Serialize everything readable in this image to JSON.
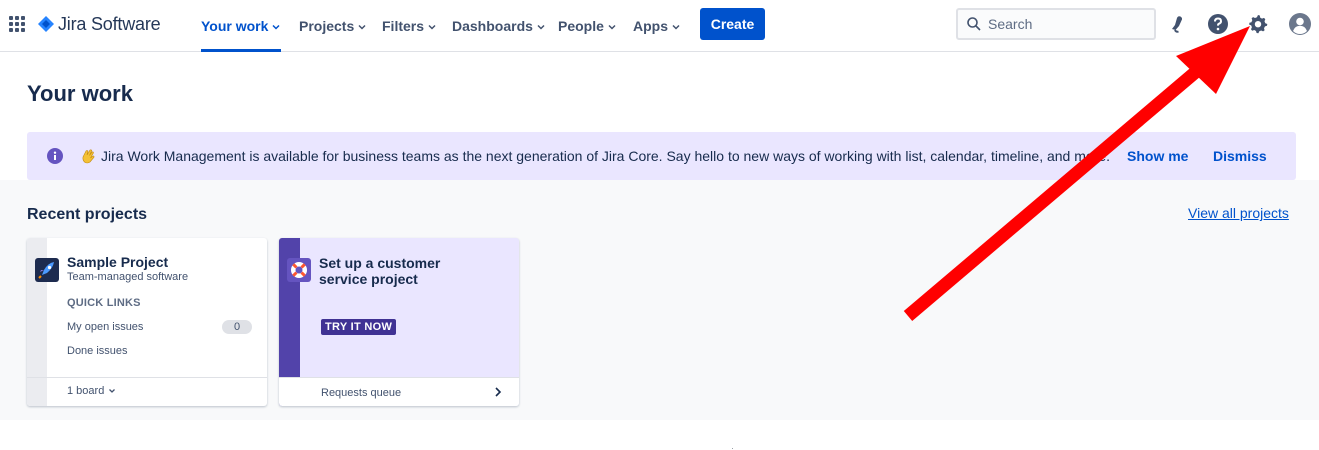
{
  "app": {
    "logo_text": "Jira Software"
  },
  "nav": {
    "items": [
      {
        "label": "Your work",
        "active": true
      },
      {
        "label": "Projects"
      },
      {
        "label": "Filters"
      },
      {
        "label": "Dashboards"
      },
      {
        "label": "People"
      },
      {
        "label": "Apps"
      }
    ],
    "create_label": "Create",
    "search_placeholder": "Search",
    "icons": [
      "notifications-icon",
      "help-icon",
      "settings-icon",
      "profile-avatar-icon"
    ]
  },
  "page": {
    "title": "Your work"
  },
  "banner": {
    "text": "Jira Work Management is available for business teams as the next generation of Jira Core. Say hello to new ways of working with list, calendar, timeline, and more.",
    "show_me": "Show me",
    "separator": "·",
    "dismiss": "Dismiss"
  },
  "recent": {
    "title": "Recent projects",
    "view_all": "View all projects",
    "project": {
      "name": "Sample Project",
      "type": "Team-managed software",
      "quick_links_label": "QUICK LINKS",
      "links": [
        {
          "label": "My open issues",
          "count": "0"
        },
        {
          "label": "Done issues"
        }
      ],
      "board_selector": "1 board"
    },
    "promo": {
      "title_line1": "Set up a customer",
      "title_line2": "service project",
      "cta": "TRY IT NOW",
      "footer_link": "Requests queue"
    }
  },
  "colors": {
    "primary": "#0052cc",
    "banner_bg": "#eae6ff",
    "promo_stripe": "#5243aa",
    "annotation_arrow": "#ff0000"
  }
}
